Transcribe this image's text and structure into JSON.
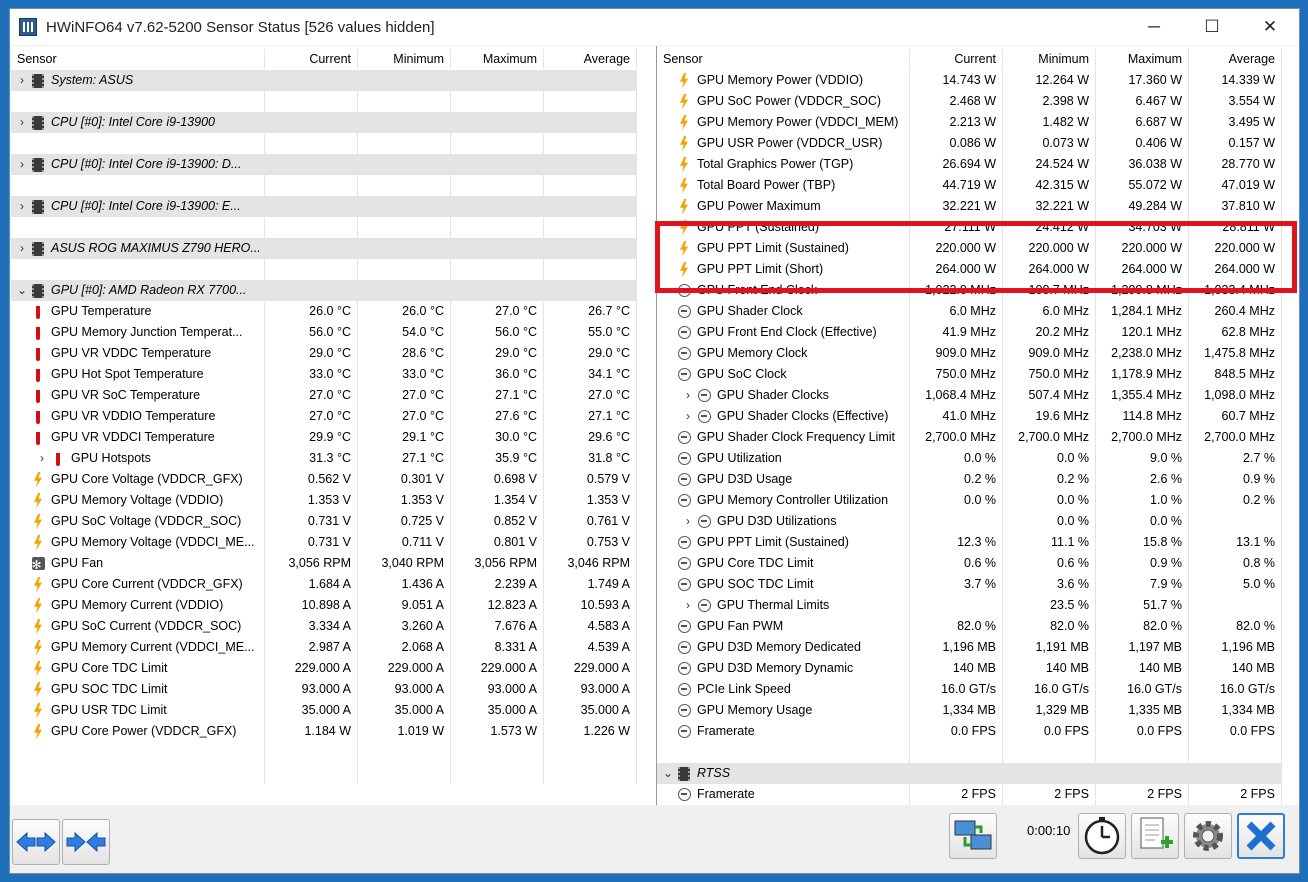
{
  "window": {
    "title": "HWiNFO64 v7.62-5200 Sensor Status [526 values hidden]",
    "minimize": "─",
    "maximize": "☐",
    "close": "✕"
  },
  "headers": {
    "sensor": "Sensor",
    "current": "Current",
    "minimum": "Minimum",
    "maximum": "Maximum",
    "average": "Average"
  },
  "left_rows": [
    {
      "type": "group",
      "exp": "›",
      "icon": "chip",
      "name": "System: ASUS"
    },
    {
      "type": "blank"
    },
    {
      "type": "group",
      "exp": "›",
      "icon": "chip",
      "name": "CPU [#0]: Intel Core i9-13900"
    },
    {
      "type": "blank"
    },
    {
      "type": "group",
      "exp": "›",
      "icon": "chip",
      "name": "CPU [#0]: Intel Core i9-13900: D..."
    },
    {
      "type": "blank"
    },
    {
      "type": "group",
      "exp": "›",
      "icon": "chip",
      "name": "CPU [#0]: Intel Core i9-13900: E..."
    },
    {
      "type": "blank"
    },
    {
      "type": "group",
      "exp": "›",
      "icon": "chip",
      "name": "ASUS ROG MAXIMUS Z790 HERO..."
    },
    {
      "type": "blank"
    },
    {
      "type": "group",
      "exp": "⌄",
      "icon": "chip",
      "name": "GPU [#0]: AMD Radeon RX 7700..."
    },
    {
      "icon": "therm",
      "name": "GPU Temperature",
      "cur": "26.0 °C",
      "min": "26.0 °C",
      "max": "27.0 °C",
      "avg": "26.7 °C"
    },
    {
      "icon": "therm",
      "name": "GPU Memory Junction Temperat...",
      "cur": "56.0 °C",
      "min": "54.0 °C",
      "max": "56.0 °C",
      "avg": "55.0 °C"
    },
    {
      "icon": "therm",
      "name": "GPU VR VDDC Temperature",
      "cur": "29.0 °C",
      "min": "28.6 °C",
      "max": "29.0 °C",
      "avg": "29.0 °C"
    },
    {
      "icon": "therm",
      "name": "GPU Hot Spot Temperature",
      "cur": "33.0 °C",
      "min": "33.0 °C",
      "max": "36.0 °C",
      "avg": "34.1 °C"
    },
    {
      "icon": "therm",
      "name": "GPU VR SoC Temperature",
      "cur": "27.0 °C",
      "min": "27.0 °C",
      "max": "27.1 °C",
      "avg": "27.0 °C"
    },
    {
      "icon": "therm",
      "name": "GPU VR VDDIO Temperature",
      "cur": "27.0 °C",
      "min": "27.0 °C",
      "max": "27.6 °C",
      "avg": "27.1 °C"
    },
    {
      "icon": "therm",
      "name": "GPU VR VDDCI Temperature",
      "cur": "29.9 °C",
      "min": "29.1 °C",
      "max": "30.0 °C",
      "avg": "29.6 °C"
    },
    {
      "exp": "›",
      "sub": true,
      "icon": "therm",
      "name": "GPU Hotspots",
      "cur": "31.3 °C",
      "min": "27.1 °C",
      "max": "35.9 °C",
      "avg": "31.8 °C"
    },
    {
      "icon": "bolt",
      "name": "GPU Core Voltage (VDDCR_GFX)",
      "cur": "0.562 V",
      "min": "0.301 V",
      "max": "0.698 V",
      "avg": "0.579 V"
    },
    {
      "icon": "bolt",
      "name": "GPU Memory Voltage (VDDIO)",
      "cur": "1.353 V",
      "min": "1.353 V",
      "max": "1.354 V",
      "avg": "1.353 V"
    },
    {
      "icon": "bolt",
      "name": "GPU SoC Voltage (VDDCR_SOC)",
      "cur": "0.731 V",
      "min": "0.725 V",
      "max": "0.852 V",
      "avg": "0.761 V"
    },
    {
      "icon": "bolt",
      "name": "GPU Memory Voltage (VDDCI_ME...",
      "cur": "0.731 V",
      "min": "0.711 V",
      "max": "0.801 V",
      "avg": "0.753 V"
    },
    {
      "icon": "fan",
      "name": "GPU Fan",
      "cur": "3,056 RPM",
      "min": "3,040 RPM",
      "max": "3,056 RPM",
      "avg": "3,046 RPM"
    },
    {
      "icon": "bolt",
      "name": "GPU Core Current (VDDCR_GFX)",
      "cur": "1.684 A",
      "min": "1.436 A",
      "max": "2.239 A",
      "avg": "1.749 A"
    },
    {
      "icon": "bolt",
      "name": "GPU Memory Current (VDDIO)",
      "cur": "10.898 A",
      "min": "9.051 A",
      "max": "12.823 A",
      "avg": "10.593 A"
    },
    {
      "icon": "bolt",
      "name": "GPU SoC Current (VDDCR_SOC)",
      "cur": "3.334 A",
      "min": "3.260 A",
      "max": "7.676 A",
      "avg": "4.583 A"
    },
    {
      "icon": "bolt",
      "name": "GPU Memory Current (VDDCI_ME...",
      "cur": "2.987 A",
      "min": "2.068 A",
      "max": "8.331 A",
      "avg": "4.539 A"
    },
    {
      "icon": "bolt",
      "name": "GPU Core TDC Limit",
      "cur": "229.000 A",
      "min": "229.000 A",
      "max": "229.000 A",
      "avg": "229.000 A"
    },
    {
      "icon": "bolt",
      "name": "GPU SOC TDC Limit",
      "cur": "93.000 A",
      "min": "93.000 A",
      "max": "93.000 A",
      "avg": "93.000 A"
    },
    {
      "icon": "bolt",
      "name": "GPU USR TDC Limit",
      "cur": "35.000 A",
      "min": "35.000 A",
      "max": "35.000 A",
      "avg": "35.000 A"
    },
    {
      "icon": "bolt",
      "name": "GPU Core Power (VDDCR_GFX)",
      "cur": "1.184 W",
      "min": "1.019 W",
      "max": "1.573 W",
      "avg": "1.226 W"
    },
    {
      "type": "blank"
    },
    {
      "type": "blank"
    }
  ],
  "right_rows": [
    {
      "icon": "bolt",
      "name": "GPU Memory Power (VDDIO)",
      "cur": "14.743 W",
      "min": "12.264 W",
      "max": "17.360 W",
      "avg": "14.339 W"
    },
    {
      "icon": "bolt",
      "name": "GPU SoC Power (VDDCR_SOC)",
      "cur": "2.468 W",
      "min": "2.398 W",
      "max": "6.467 W",
      "avg": "3.554 W"
    },
    {
      "icon": "bolt",
      "name": "GPU Memory Power (VDDCI_MEM)",
      "cur": "2.213 W",
      "min": "1.482 W",
      "max": "6.687 W",
      "avg": "3.495 W"
    },
    {
      "icon": "bolt",
      "name": "GPU USR Power (VDDCR_USR)",
      "cur": "0.086 W",
      "min": "0.073 W",
      "max": "0.406 W",
      "avg": "0.157 W"
    },
    {
      "icon": "bolt",
      "name": "Total Graphics Power (TGP)",
      "cur": "26.694 W",
      "min": "24.524 W",
      "max": "36.038 W",
      "avg": "28.770 W"
    },
    {
      "icon": "bolt",
      "name": "Total Board Power (TBP)",
      "cur": "44.719 W",
      "min": "42.315 W",
      "max": "55.072 W",
      "avg": "47.019 W"
    },
    {
      "icon": "bolt",
      "name": "GPU Power Maximum",
      "cur": "32.221 W",
      "min": "32.221 W",
      "max": "49.284 W",
      "avg": "37.810 W"
    },
    {
      "icon": "bolt",
      "name": "GPU PPT (Sustained)",
      "cur": "27.111 W",
      "min": "24.412 W",
      "max": "34.703 W",
      "avg": "28.811 W"
    },
    {
      "icon": "bolt",
      "name": "GPU PPT Limit (Sustained)",
      "cur": "220.000 W",
      "min": "220.000 W",
      "max": "220.000 W",
      "avg": "220.000 W"
    },
    {
      "icon": "bolt",
      "name": "GPU PPT Limit (Short)",
      "cur": "264.000 W",
      "min": "264.000 W",
      "max": "264.000 W",
      "avg": "264.000 W"
    },
    {
      "icon": "clock",
      "name": "GPU Front End Clock",
      "cur": "1,022.0 MHz",
      "min": "100.7 MHz",
      "max": "1,299.8 MHz",
      "avg": "1,033.4 MHz"
    },
    {
      "icon": "clock",
      "name": "GPU Shader Clock",
      "cur": "6.0 MHz",
      "min": "6.0 MHz",
      "max": "1,284.1 MHz",
      "avg": "260.4 MHz"
    },
    {
      "icon": "clock",
      "name": "GPU Front End Clock (Effective)",
      "cur": "41.9 MHz",
      "min": "20.2 MHz",
      "max": "120.1 MHz",
      "avg": "62.8 MHz"
    },
    {
      "icon": "clock",
      "name": "GPU Memory Clock",
      "cur": "909.0 MHz",
      "min": "909.0 MHz",
      "max": "2,238.0 MHz",
      "avg": "1,475.8 MHz"
    },
    {
      "icon": "clock",
      "name": "GPU SoC Clock",
      "cur": "750.0 MHz",
      "min": "750.0 MHz",
      "max": "1,178.9 MHz",
      "avg": "848.5 MHz"
    },
    {
      "exp": "›",
      "sub": true,
      "icon": "clock",
      "name": "GPU Shader Clocks",
      "cur": "1,068.4 MHz",
      "min": "507.4 MHz",
      "max": "1,355.4 MHz",
      "avg": "1,098.0 MHz"
    },
    {
      "exp": "›",
      "sub": true,
      "icon": "clock",
      "name": "GPU Shader Clocks (Effective)",
      "cur": "41.0 MHz",
      "min": "19.6 MHz",
      "max": "114.8 MHz",
      "avg": "60.7 MHz"
    },
    {
      "icon": "clock",
      "name": "GPU Shader Clock Frequency Limit",
      "cur": "2,700.0 MHz",
      "min": "2,700.0 MHz",
      "max": "2,700.0 MHz",
      "avg": "2,700.0 MHz"
    },
    {
      "icon": "clock",
      "name": "GPU Utilization",
      "cur": "0.0 %",
      "min": "0.0 %",
      "max": "9.0 %",
      "avg": "2.7 %"
    },
    {
      "icon": "clock",
      "name": "GPU D3D Usage",
      "cur": "0.2 %",
      "min": "0.2 %",
      "max": "2.6 %",
      "avg": "0.9 %"
    },
    {
      "icon": "clock",
      "name": "GPU Memory Controller Utilization",
      "cur": "0.0 %",
      "min": "0.0 %",
      "max": "1.0 %",
      "avg": "0.2 %"
    },
    {
      "exp": "›",
      "sub": true,
      "icon": "clock",
      "name": "GPU D3D Utilizations",
      "cur": "",
      "min": "0.0 %",
      "max": "0.0 %",
      "avg": ""
    },
    {
      "icon": "clock",
      "name": "GPU PPT Limit (Sustained)",
      "cur": "12.3 %",
      "min": "11.1 %",
      "max": "15.8 %",
      "avg": "13.1 %"
    },
    {
      "icon": "clock",
      "name": "GPU Core TDC Limit",
      "cur": "0.6 %",
      "min": "0.6 %",
      "max": "0.9 %",
      "avg": "0.8 %"
    },
    {
      "icon": "clock",
      "name": "GPU SOC TDC Limit",
      "cur": "3.7 %",
      "min": "3.6 %",
      "max": "7.9 %",
      "avg": "5.0 %"
    },
    {
      "exp": "›",
      "sub": true,
      "icon": "clock",
      "name": "GPU Thermal Limits",
      "cur": "",
      "min": "23.5 %",
      "max": "51.7 %",
      "avg": ""
    },
    {
      "icon": "clock",
      "name": "GPU Fan PWM",
      "cur": "82.0 %",
      "min": "82.0 %",
      "max": "82.0 %",
      "avg": "82.0 %"
    },
    {
      "icon": "clock",
      "name": "GPU D3D Memory Dedicated",
      "cur": "1,196 MB",
      "min": "1,191 MB",
      "max": "1,197 MB",
      "avg": "1,196 MB"
    },
    {
      "icon": "clock",
      "name": "GPU D3D Memory Dynamic",
      "cur": "140 MB",
      "min": "140 MB",
      "max": "140 MB",
      "avg": "140 MB"
    },
    {
      "icon": "clock",
      "name": "PCIe Link Speed",
      "cur": "16.0 GT/s",
      "min": "16.0 GT/s",
      "max": "16.0 GT/s",
      "avg": "16.0 GT/s"
    },
    {
      "icon": "clock",
      "name": "GPU Memory Usage",
      "cur": "1,334 MB",
      "min": "1,329 MB",
      "max": "1,335 MB",
      "avg": "1,334 MB"
    },
    {
      "icon": "clock",
      "name": "Framerate",
      "cur": "0.0 FPS",
      "min": "0.0 FPS",
      "max": "0.0 FPS",
      "avg": "0.0 FPS"
    },
    {
      "type": "blank"
    },
    {
      "type": "group",
      "exp": "⌄",
      "icon": "chip",
      "name": "RTSS"
    },
    {
      "icon": "clock",
      "name": "Framerate",
      "cur": "2 FPS",
      "min": "2 FPS",
      "max": "2 FPS",
      "avg": "2 FPS"
    }
  ],
  "toolbar": {
    "timer": "0:00:10"
  },
  "colors": {
    "highlight": "#e0141e",
    "group_bg": "#e4e4e4",
    "titlebar": "#ffffff",
    "desktop": "#1f6fb8"
  },
  "icons": {
    "expand": "chevron-right-icon",
    "collapse": "chevron-down-icon",
    "group": "chip-icon",
    "temperature": "thermometer-icon",
    "power": "bolt-icon",
    "clock": "clock-icon",
    "fan": "fan-icon"
  }
}
